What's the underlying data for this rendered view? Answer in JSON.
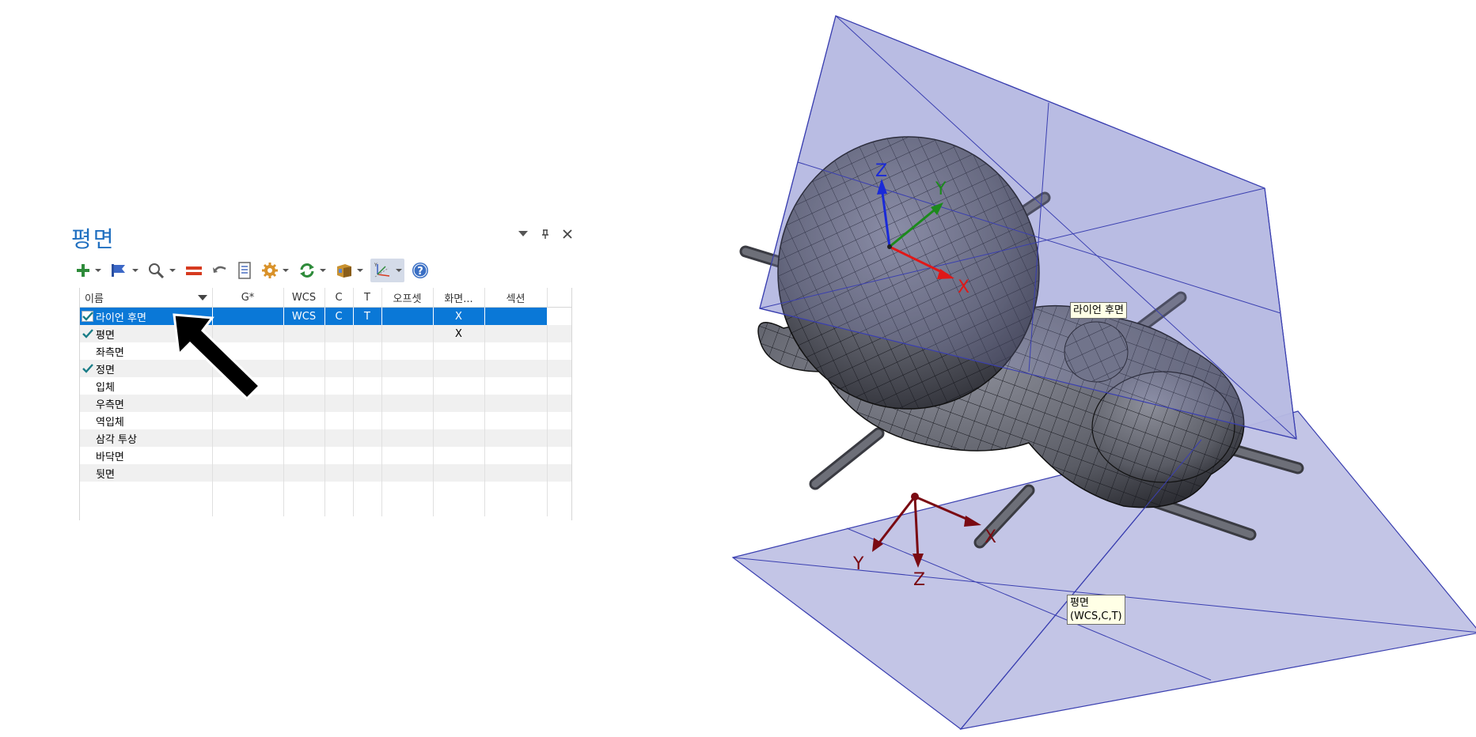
{
  "panel": {
    "title": "평면",
    "controls": {
      "menu_icon": "dropdown-triangle-icon",
      "pin_icon": "pin-icon",
      "close_icon": "close-icon"
    },
    "toolbar": [
      {
        "name": "add-plane",
        "icon": "plus-icon",
        "dropdown": true
      },
      {
        "name": "flag",
        "icon": "flag-icon",
        "dropdown": true
      },
      {
        "name": "find",
        "icon": "magnifier-icon",
        "dropdown": true
      },
      {
        "name": "equal",
        "icon": "equals-icon",
        "dropdown": false
      },
      {
        "name": "undo",
        "icon": "undo-icon",
        "dropdown": false
      },
      {
        "name": "properties",
        "icon": "document-icon",
        "dropdown": false
      },
      {
        "name": "settings",
        "icon": "gear-icon",
        "dropdown": true
      },
      {
        "name": "refresh",
        "icon": "refresh-icon",
        "dropdown": true
      },
      {
        "name": "book",
        "icon": "book-icon",
        "dropdown": true
      },
      {
        "name": "axes",
        "icon": "axes-icon",
        "dropdown": true,
        "active": true
      },
      {
        "name": "help",
        "icon": "help-icon",
        "dropdown": false
      }
    ],
    "columns": [
      "이름",
      "G*",
      "WCS",
      "C",
      "T",
      "오프셋",
      "화면...",
      "섹션"
    ],
    "rows": [
      {
        "checked": true,
        "name": "라이언 후면",
        "g": "",
        "wcs": "WCS",
        "c": "C",
        "t": "T",
        "offset": "",
        "screen": "X",
        "section": "",
        "selected": true
      },
      {
        "checked": true,
        "name": "평면",
        "g": "",
        "wcs": "",
        "c": "",
        "t": "",
        "offset": "",
        "screen": "X",
        "section": ""
      },
      {
        "checked": false,
        "name": "좌측면",
        "g": "",
        "wcs": "",
        "c": "",
        "t": "",
        "offset": "",
        "screen": "",
        "section": ""
      },
      {
        "checked": true,
        "name": "정면",
        "g": "",
        "wcs": "",
        "c": "",
        "t": "",
        "offset": "",
        "screen": "",
        "section": ""
      },
      {
        "checked": false,
        "name": "입체",
        "g": "",
        "wcs": "",
        "c": "",
        "t": "",
        "offset": "",
        "screen": "",
        "section": ""
      },
      {
        "checked": false,
        "name": "우측면",
        "g": "",
        "wcs": "",
        "c": "",
        "t": "",
        "offset": "",
        "screen": "",
        "section": ""
      },
      {
        "checked": false,
        "name": "역입체",
        "g": "",
        "wcs": "",
        "c": "",
        "t": "",
        "offset": "",
        "screen": "",
        "section": ""
      },
      {
        "checked": false,
        "name": "삼각 투상",
        "g": "",
        "wcs": "",
        "c": "",
        "t": "",
        "offset": "",
        "screen": "",
        "section": ""
      },
      {
        "checked": false,
        "name": "바닥면",
        "g": "",
        "wcs": "",
        "c": "",
        "t": "",
        "offset": "",
        "screen": "",
        "section": ""
      },
      {
        "checked": false,
        "name": "뒷면",
        "g": "",
        "wcs": "",
        "c": "",
        "t": "",
        "offset": "",
        "screen": "",
        "section": ""
      }
    ]
  },
  "viewport": {
    "upper_axes": {
      "x": "X",
      "y": "Y",
      "z": "Z"
    },
    "lower_axes": {
      "x": "X",
      "y": "Y",
      "z": "Z"
    },
    "tooltip_upper": "라이언 후면",
    "tooltip_lower_line1": "평면",
    "tooltip_lower_line2": "(WCS,C,T)",
    "colors": {
      "plane_fill": "#c3c5e6",
      "plane_edge": "#3a3fb0",
      "model": "#5e6069",
      "axis_x_upper": "#e01818",
      "axis_y_upper": "#1c8a1c",
      "axis_z_upper": "#1a2ad8",
      "axis_lower": "#7a0a12",
      "selection": "#0a78d7",
      "title_blue": "#1f6fc0"
    }
  }
}
